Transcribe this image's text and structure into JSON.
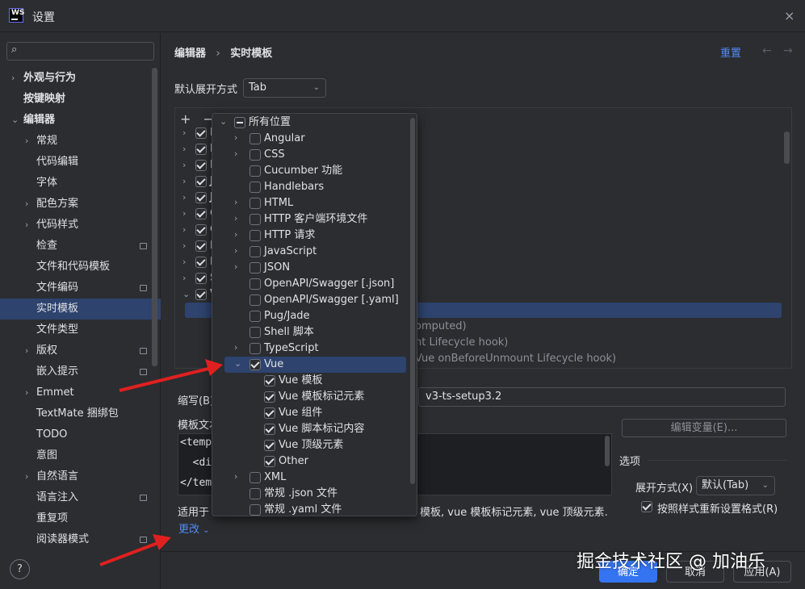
{
  "window": {
    "title": "设置",
    "close_icon": "×"
  },
  "sidebar": {
    "search_placeholder": "",
    "items": [
      {
        "label": "外观与行为",
        "chevron": "›",
        "pin": false
      },
      {
        "label": "按键映射",
        "chevron": "",
        "pin": false
      },
      {
        "label": "编辑器",
        "chevron": "⌄",
        "pin": false
      },
      {
        "label": "常规",
        "chevron": "›",
        "pin": false
      },
      {
        "label": "代码编辑",
        "chevron": "",
        "pin": false
      },
      {
        "label": "字体",
        "chevron": "",
        "pin": false
      },
      {
        "label": "配色方案",
        "chevron": "›",
        "pin": false
      },
      {
        "label": "代码样式",
        "chevron": "›",
        "pin": false
      },
      {
        "label": "检查",
        "chevron": "",
        "pin": true
      },
      {
        "label": "文件和代码模板",
        "chevron": "",
        "pin": false
      },
      {
        "label": "文件编码",
        "chevron": "",
        "pin": true
      },
      {
        "label": "实时模板",
        "chevron": "",
        "pin": false,
        "selected": true
      },
      {
        "label": "文件类型",
        "chevron": "",
        "pin": false
      },
      {
        "label": "版权",
        "chevron": "›",
        "pin": true
      },
      {
        "label": "嵌入提示",
        "chevron": "",
        "pin": true
      },
      {
        "label": "Emmet",
        "chevron": "›",
        "pin": false
      },
      {
        "label": "TextMate 捆绑包",
        "chevron": "",
        "pin": false
      },
      {
        "label": "TODO",
        "chevron": "",
        "pin": false
      },
      {
        "label": "意图",
        "chevron": "",
        "pin": false
      },
      {
        "label": "自然语言",
        "chevron": "›",
        "pin": false
      },
      {
        "label": "语言注入",
        "chevron": "",
        "pin": true
      },
      {
        "label": "重复项",
        "chevron": "",
        "pin": false
      },
      {
        "label": "阅读器模式",
        "chevron": "",
        "pin": true
      }
    ],
    "help": "?"
  },
  "header": {
    "crumb1": "编辑器",
    "sep": "›",
    "crumb2": "实时模板",
    "reset": "重置",
    "back": "←",
    "forward": "→"
  },
  "expand": {
    "label": "默认展开方式",
    "value": "Tab"
  },
  "toolbar": {
    "add": "+",
    "remove": "−"
  },
  "background_rows": [
    {
      "letter": "H"
    },
    {
      "letter": "H"
    },
    {
      "letter": "H"
    },
    {
      "letter": "J"
    },
    {
      "letter": "J"
    },
    {
      "letter": "C"
    },
    {
      "letter": "C"
    },
    {
      "letter": "F"
    },
    {
      "letter": "F"
    },
    {
      "letter": "S"
    },
    {
      "letter": "V"
    }
  ],
  "faded_rows": [
    "omputed)",
    "nt Lifecycle hook)",
    "Vue onBeforeUnmount Lifecycle hook)"
  ],
  "abbr": {
    "label": "缩写(B):",
    "value": "v3-ts-setup3.2"
  },
  "edit_vars": "编辑变量(E)...",
  "template_text": {
    "label": "模板文本",
    "lines": [
      "<templ",
      "  <div",
      "</temp"
    ]
  },
  "options": {
    "title": "选项",
    "expand_label": "展开方式(X)",
    "expand_value": "默认(Tab)",
    "reformat": "按照样式重新设置格式(R)"
  },
  "applies": {
    "prefix": "适用于",
    "suffix": "模板, vue 模板标记元素, vue 顶级元素.",
    "change": "更改"
  },
  "buttons": {
    "ok": "确定",
    "cancel": "取消",
    "apply": "应用(A)"
  },
  "popup": {
    "items": [
      {
        "label": "所有位置",
        "chevron": "⌄",
        "state": "partial",
        "indent": 0
      },
      {
        "label": "Angular",
        "chevron": "›",
        "state": "unchecked",
        "indent": 1
      },
      {
        "label": "CSS",
        "chevron": "›",
        "state": "unchecked",
        "indent": 1
      },
      {
        "label": "Cucumber 功能",
        "chevron": "",
        "state": "unchecked",
        "indent": 1
      },
      {
        "label": "Handlebars",
        "chevron": "",
        "state": "unchecked",
        "indent": 1
      },
      {
        "label": "HTML",
        "chevron": "›",
        "state": "unchecked",
        "indent": 1
      },
      {
        "label": "HTTP 客户端环境文件",
        "chevron": "›",
        "state": "unchecked",
        "indent": 1
      },
      {
        "label": "HTTP 请求",
        "chevron": "›",
        "state": "unchecked",
        "indent": 1
      },
      {
        "label": "JavaScript",
        "chevron": "›",
        "state": "unchecked",
        "indent": 1
      },
      {
        "label": "JSON",
        "chevron": "›",
        "state": "unchecked",
        "indent": 1
      },
      {
        "label": "OpenAPI/Swagger [.json]",
        "chevron": "",
        "state": "unchecked",
        "indent": 1
      },
      {
        "label": "OpenAPI/Swagger [.yaml]",
        "chevron": "",
        "state": "unchecked",
        "indent": 1
      },
      {
        "label": "Pug/Jade",
        "chevron": "",
        "state": "unchecked",
        "indent": 1
      },
      {
        "label": "Shell 脚本",
        "chevron": "",
        "state": "unchecked",
        "indent": 1
      },
      {
        "label": "TypeScript",
        "chevron": "›",
        "state": "unchecked",
        "indent": 1
      },
      {
        "label": "Vue",
        "chevron": "⌄",
        "state": "checked",
        "indent": 1,
        "selected": true
      },
      {
        "label": "Vue 模板",
        "chevron": "",
        "state": "checked",
        "indent": 2
      },
      {
        "label": "Vue 模板标记元素",
        "chevron": "",
        "state": "checked",
        "indent": 2
      },
      {
        "label": "Vue 组件",
        "chevron": "",
        "state": "checked",
        "indent": 2
      },
      {
        "label": "Vue 脚本标记内容",
        "chevron": "",
        "state": "checked",
        "indent": 2
      },
      {
        "label": "Vue 顶级元素",
        "chevron": "",
        "state": "checked",
        "indent": 2
      },
      {
        "label": "Other",
        "chevron": "",
        "state": "checked",
        "indent": 2
      },
      {
        "label": "XML",
        "chevron": "›",
        "state": "unchecked",
        "indent": 1
      },
      {
        "label": "常规 .json 文件",
        "chevron": "",
        "state": "unchecked",
        "indent": 1
      },
      {
        "label": "常规 .yaml 文件",
        "chevron": "",
        "state": "unchecked",
        "indent": 1
      }
    ]
  },
  "watermark": "掘金技术社区 @ 加油乐",
  "colors": {
    "accent": "#548af7",
    "selection": "#2e436e",
    "arrow": "#e02020"
  }
}
